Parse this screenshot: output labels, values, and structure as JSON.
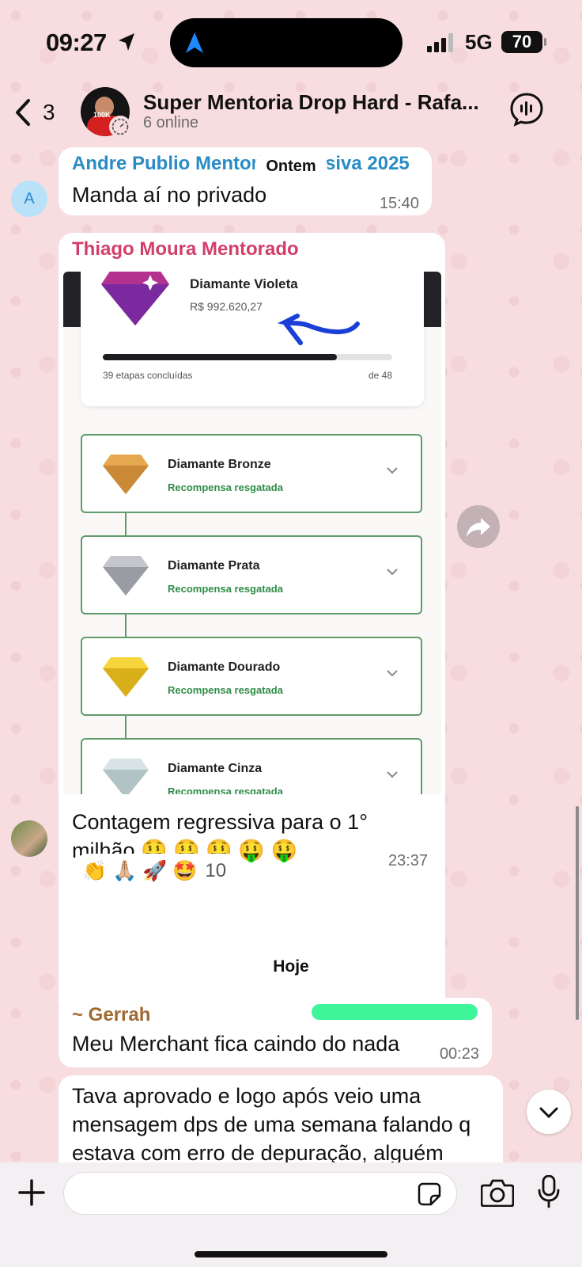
{
  "status_bar": {
    "time": "09:27",
    "network": "5G",
    "battery": "70"
  },
  "header": {
    "back_count": "3",
    "title": "Super Mentoria Drop Hard - Rafa...",
    "subtitle": "6 online",
    "avatar_logo": "100K"
  },
  "messages": {
    "andre": {
      "sender": "Andre Publio Mentoria Intensiva 2025",
      "text": "Manda aí no privado",
      "time": "15:40",
      "avatar_letter": "A",
      "sender_color": "#2a8cc4"
    },
    "date_ontem": "Ontem",
    "thiago": {
      "sender": "Thiago Moura Mentorado",
      "sender_color": "#d23d6a",
      "text_line1": "Contagem regressiva para o 1°",
      "text_line2": "milhão 🤑 🤑 🤑 🤑 🤑",
      "time": "23:37",
      "reactions": "👏 🙏🏼 🚀 🤩",
      "reaction_count": "10",
      "image": {
        "top_title": "Diamante Violeta",
        "top_value": "R$ 992.620,27",
        "progress": 0.81,
        "steps_label": "39 etapas concluídas",
        "steps_total": "de 48",
        "tiers": [
          {
            "name": "Diamante Bronze",
            "status": "Recompensa resgatada",
            "color": "#e6a84e"
          },
          {
            "name": "Diamante Prata",
            "status": "Recompensa resgatada",
            "color": "#b9bcc3"
          },
          {
            "name": "Diamante Dourado",
            "status": "Recompensa resgatada",
            "color": "#f2cb2a"
          },
          {
            "name": "Diamante Cinza",
            "status": "Recompensa resgatada",
            "color": "#c9d6d8"
          }
        ]
      }
    },
    "date_hoje": "Hoje",
    "gerrah": {
      "sender": "~ Gerrah",
      "sender_color": "#a0692f",
      "text": "Meu Merchant fica caindo do nada",
      "time": "00:23"
    },
    "gerrah2": {
      "line1": "Tava aprovado e logo após veio uma",
      "line2": "mensagem dps de uma semana falando q",
      "line3": "estava com erro de depuração, alguém"
    }
  }
}
